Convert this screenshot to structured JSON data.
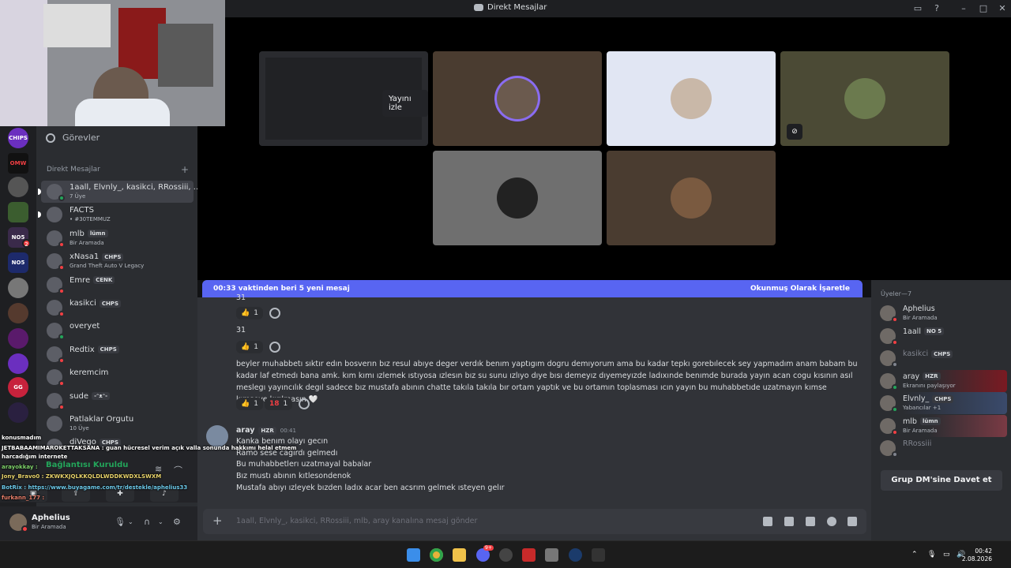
{
  "window": {
    "title": "Direkt Mesajlar"
  },
  "sidebar": {
    "tasks_label": "Görevler",
    "dm_header": "Direkt Mesajlar",
    "dms": [
      {
        "name": "1aall, Elvnly_, kasikci, RRossiii, ...",
        "sub": "7 Üye",
        "status": "on",
        "active": true,
        "unread": true
      },
      {
        "name": "FACTS",
        "sub": "• #30TEMMUZ",
        "status": "none",
        "unread": true
      },
      {
        "name": "mlb",
        "tag": "lümn",
        "sub": "Bir Aramada",
        "status": "dnd"
      },
      {
        "name": "xNasa1",
        "tag": "CHPS",
        "sub": "Grand Theft Auto V Legacy",
        "status": "dnd"
      },
      {
        "name": "Emre",
        "tag": "CENK",
        "sub": "",
        "status": "dnd"
      },
      {
        "name": "kasikci",
        "tag": "CHPS",
        "sub": "",
        "status": "dnd"
      },
      {
        "name": "overyet",
        "sub": "",
        "status": "on"
      },
      {
        "name": "Redtix",
        "tag": "CHPS",
        "sub": "",
        "status": "dnd"
      },
      {
        "name": "keremcim",
        "sub": "",
        "status": "dnd"
      },
      {
        "name": "sude",
        "tag": "-ᵔᴥᵔ-",
        "sub": "",
        "status": "dnd"
      },
      {
        "name": "Patlaklar Orgutu",
        "sub": "10 Üye",
        "status": "none"
      },
      {
        "name": "diVego",
        "tag": "CHPS",
        "sub": "",
        "status": "none"
      }
    ],
    "servers": [
      "CHIPS",
      "OMW",
      "",
      "",
      "NO5",
      "NO5",
      "",
      "",
      "",
      "",
      "GG",
      ""
    ],
    "server_badge": "2",
    "voice_status": "Bağlantısı Kuruldu",
    "user": {
      "name": "Aphelius",
      "status": "Bir Aramada"
    }
  },
  "stream": {
    "watch_label": "Yayını izle"
  },
  "chat": {
    "banner_left": "00:33 vaktinden beri 5 yeni mesaj",
    "banner_right": "Okunmuş Olarak İşaretle",
    "msg_top": "31",
    "msg_31": "31",
    "react_count": "1",
    "react_18": "18",
    "long_msg": "beyler muhabbetı sıktır edın bosverın bız resul abıye deger verdık benım yaptıgım dogru demıyorum ama bu kadar tepkı gorebılecek sey yapmadım anam babam bu kadar laf etmedı bana amk. kım kımı ızlemek ıstıyosa ızlesın bız su sunu ızlıyo dıye bısı demeyız dıyemeyızde ladıxınde benımde burada yayın acan cogu kısının asıl meslegı yayıncılık degıl sadece bız mustafa abının chatte takıla takıla bır ortam yaptık ve bu ortamın toplasması ıcın yayın bu muhabbetıde uzatmayın kımse kımseye kırılmasın 🤍",
    "author": {
      "name": "aray",
      "tag": "HZR",
      "time": "00:41"
    },
    "lines": [
      "Kanka benım olayı gecın",
      "Ramo sese cagırdı gelmedı",
      "Bu muhabbetlerı uzatmayal babalar",
      "Bız mustı abının kıtlesondenok",
      "Mustafa abıyı ızleyek bızden ladıx acar ben acsrım gelmek ısteyen gelır"
    ],
    "input_placeholder": "1aall, Elvnly_, kasikci, RRossiii, mlb, aray kanalına mesaj gönder"
  },
  "members": {
    "header": "Üyeler—7",
    "list": [
      {
        "name": "Aphelius",
        "sub": "Bir Aramada",
        "status": "dnd"
      },
      {
        "name": "1aall",
        "tag": "NO 5",
        "sub": "",
        "status": "dnd"
      },
      {
        "name": "kasikci",
        "tag": "CHPS",
        "sub": "",
        "status": "off"
      },
      {
        "name": "aray",
        "tag": "HZR",
        "sub": "Ekranını paylaşıyor",
        "status": "on"
      },
      {
        "name": "Elvnly_",
        "tag": "CHPS",
        "sub": "Yabancılar +1",
        "status": "on"
      },
      {
        "name": "mlb",
        "tag": "lümn",
        "sub": "Bir Aramada",
        "status": "dnd"
      },
      {
        "name": "RRossiii",
        "sub": "",
        "status": "off"
      }
    ],
    "invite_label": "Grup DM'sine Davet et"
  },
  "stream_overlay": {
    "lines": [
      "konusmadım",
      "JETBABAAMIMAROKETTAKSANA : guan hücresel verim açık valla sonunda hakkımı helal etmem",
      "harcadığım internete",
      "arayokkay :",
      "Jony_Bravo0 : ZKWKXJQLKKQLDLWDDKWDXLSWXM",
      "BotRix : https://www.buyagame.com/tr/destekle/aphelius33",
      "furkann_177 :"
    ]
  },
  "taskbar": {
    "time": "00:42",
    "date": "2.08.2026",
    "badge": "9+"
  }
}
